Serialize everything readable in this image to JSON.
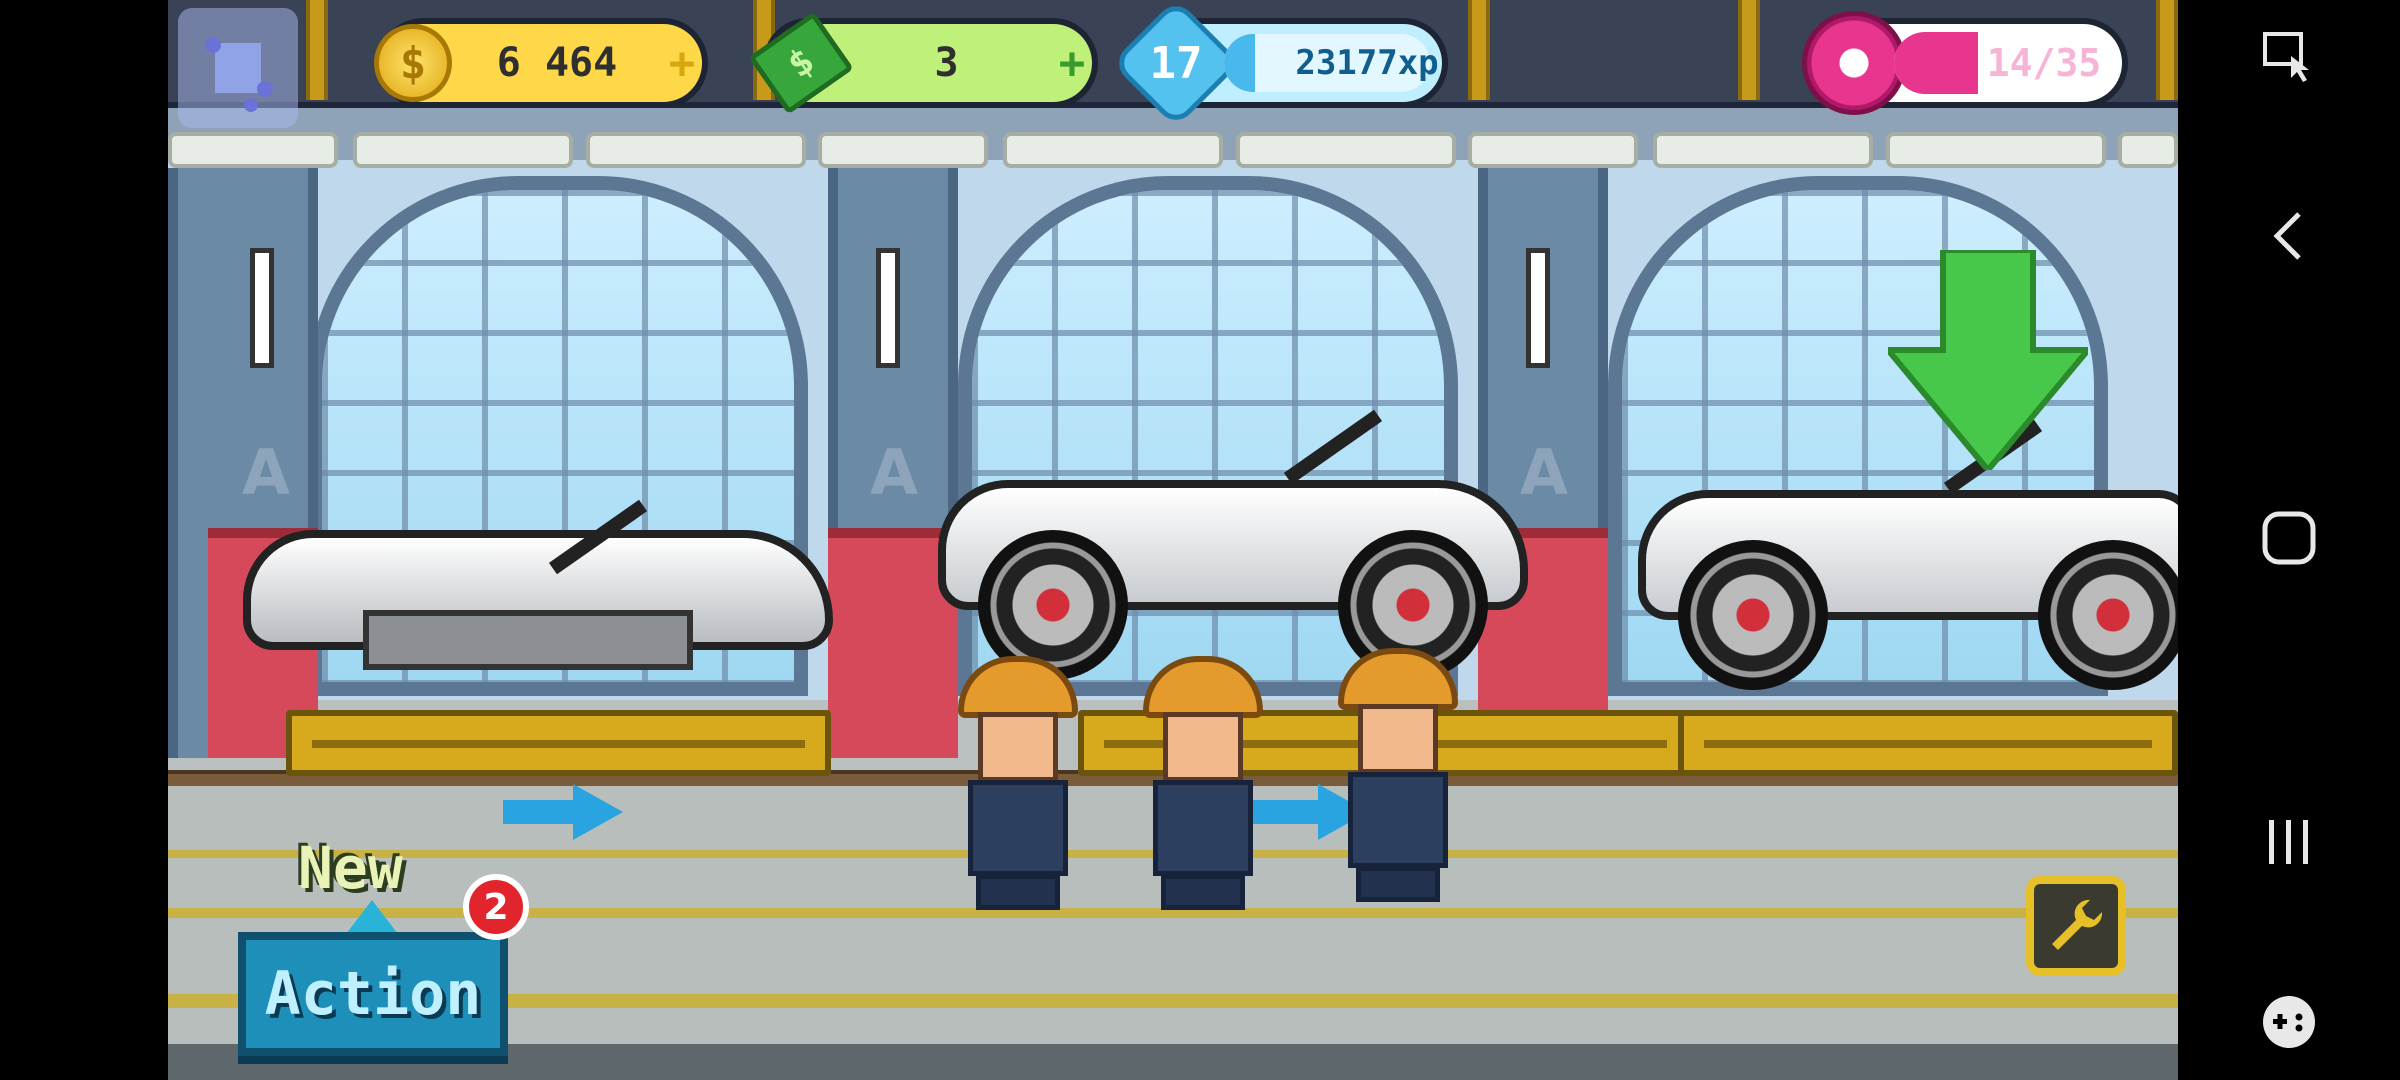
{
  "hud": {
    "coins": {
      "value": "6 464",
      "plus": "+"
    },
    "cash": {
      "value": "3",
      "plus": "+"
    },
    "level": {
      "number": "17",
      "xp": "23177xp",
      "xp_progress": 0.15
    },
    "donuts": {
      "value": "14/35",
      "current": 14,
      "max": 35
    }
  },
  "actions": {
    "new_label": "New",
    "action_button": "Action",
    "badge_count": "2"
  },
  "icons": [
    "coin-icon",
    "cash-icon",
    "level-star-icon",
    "donut-icon",
    "wrench-icon",
    "down-arrow-icon",
    "back-icon",
    "home-icon",
    "recents-icon",
    "game-tools-icon",
    "screenshot-tool-icon"
  ],
  "colors": {
    "coin_pill": "#ffd84a",
    "cash_pill": "#bff07a",
    "xp_pill": "#bfeeff",
    "donut_pill": "#ffffff",
    "donut_fill": "#e8368f",
    "action_button": "#1d8fb8",
    "badge": "#e2252d",
    "arrow": "#48c84a"
  }
}
